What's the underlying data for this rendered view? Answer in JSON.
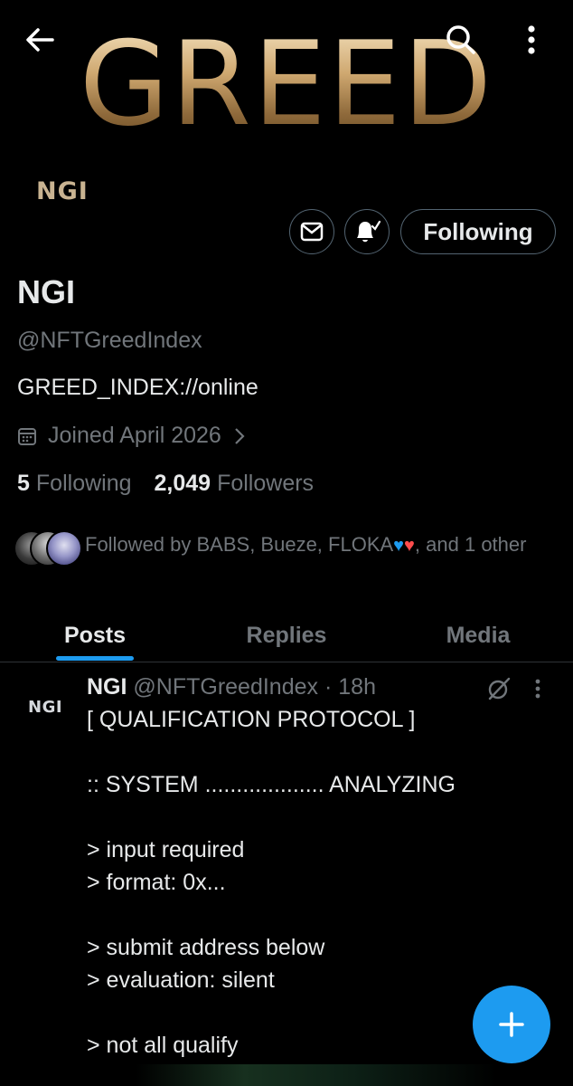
{
  "banner": {
    "wordmark": "GREED"
  },
  "profile": {
    "avatar_text": "NGI",
    "display_name": "NGI",
    "handle": "@NFTGreedIndex",
    "bio": "GREED_INDEX://online",
    "joined": "Joined April 2026",
    "following_count": "5",
    "following_label": "Following",
    "followers_count": "2,049",
    "followers_label": "Followers",
    "followed_by_prefix": "Followed by BABS, Bueze, FLOKA",
    "followed_by_suffix": ", and 1 other",
    "follow_button_label": "Following"
  },
  "tabs": [
    {
      "label": "Posts",
      "active": true
    },
    {
      "label": "Replies",
      "active": false
    },
    {
      "label": "Media",
      "active": false
    }
  ],
  "post": {
    "avatar_text": "NGI",
    "author_name": "NGI",
    "author_handle": "@NFTGreedIndex",
    "separator": "·",
    "time": "18h",
    "body": "[ QUALIFICATION PROTOCOL ]\n\n:: SYSTEM ................... ANALYZING\n\n> input required\n> format: 0x...\n\n> submit address below\n> evaluation: silent\n\n> not all qualify"
  },
  "icons": {
    "back": "arrow-left-icon",
    "search": "search-icon",
    "more": "more-vertical-icon",
    "mail": "mail-icon",
    "bell": "bell-subscribed-icon",
    "calendar": "calendar-icon",
    "grok": "grok-icon",
    "compose": "plus-icon"
  },
  "colors": {
    "accent": "#1d9bf0",
    "muted": "#71767b",
    "text": "#e7e9ea",
    "gold": "#cfa870"
  }
}
